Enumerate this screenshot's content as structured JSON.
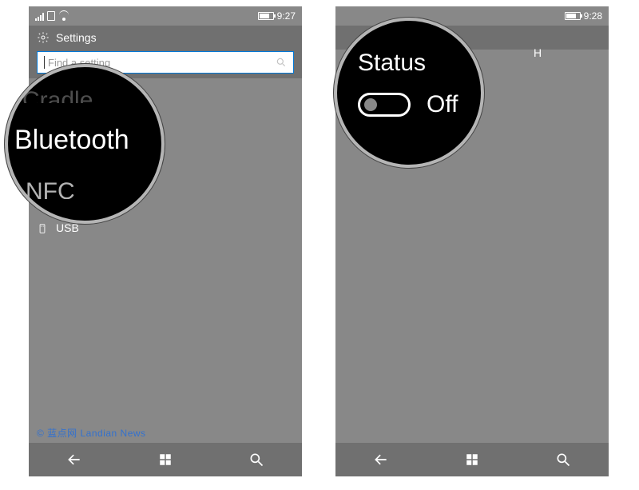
{
  "left_phone": {
    "statusbar": {
      "time": "9:27"
    },
    "header": {
      "title": "Settings"
    },
    "search": {
      "placeholder": "Find a setting"
    },
    "list": {
      "usb": {
        "label": "USB"
      }
    },
    "magnifier": {
      "item_above": "Cradle",
      "item_main": "Bluetooth",
      "item_below": "NFC"
    },
    "watermark": "© 蓝点网 Landian News"
  },
  "right_phone": {
    "statusbar": {
      "time": "9:28"
    },
    "header_fragment": "H",
    "magnifier": {
      "status_label": "Status",
      "toggle_value": "Off"
    }
  }
}
